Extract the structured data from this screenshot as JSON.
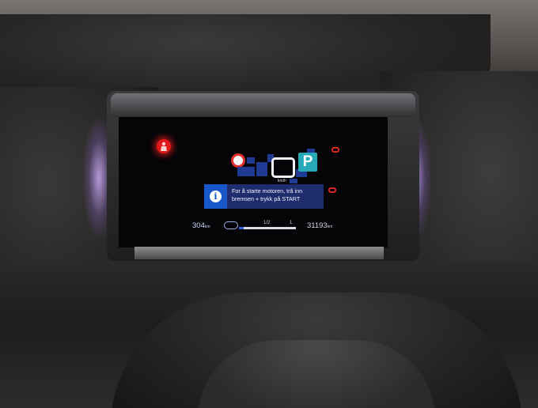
{
  "cluster": {
    "message": {
      "icon": "info-icon",
      "line1": "For å starte motoren, trå inn",
      "line2": "bremsen + trykk på START"
    },
    "gear": "P",
    "speed_unit": "km/h",
    "range": {
      "value": "304",
      "unit": "km"
    },
    "odometer": {
      "value": "31193",
      "unit": "km"
    },
    "fuel_gauge": {
      "tick_half": "1/2",
      "tick_full": "1",
      "fill_fraction": 0.08
    },
    "colors": {
      "warning": "#e01818",
      "info_icon_bg": "#1757c9",
      "message_bg": "#1f2c6e",
      "gear_bg": "#27a9b8",
      "ambient": "#b59ad8"
    }
  }
}
